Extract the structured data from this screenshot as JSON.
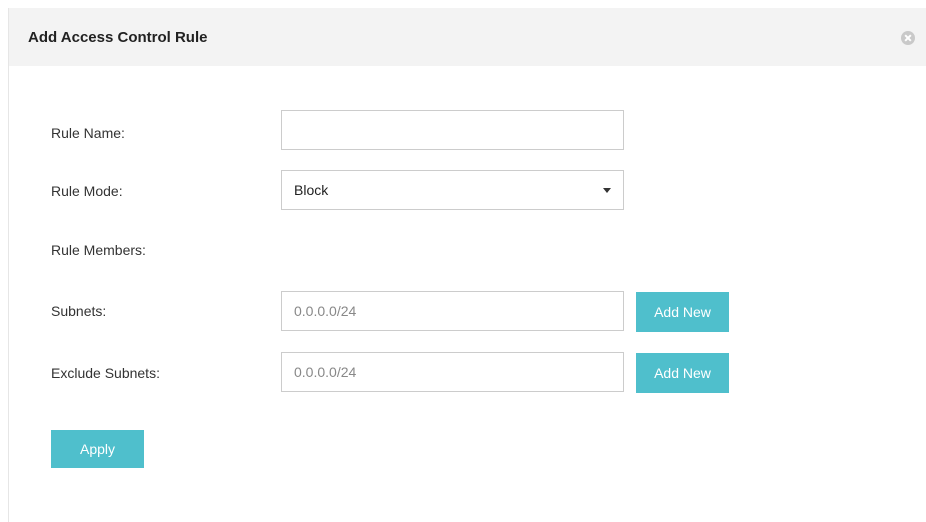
{
  "dialog": {
    "title": "Add Access Control Rule",
    "close_icon": "close-circle-icon"
  },
  "form": {
    "rule_name": {
      "label": "Rule Name:",
      "value": "",
      "placeholder": ""
    },
    "rule_mode": {
      "label": "Rule Mode:",
      "value": "Block",
      "icon": "caret-down-icon"
    },
    "rule_members": {
      "label": "Rule Members:"
    },
    "subnets": {
      "label": "Subnets:",
      "placeholder": "0.0.0.0/24",
      "add_label": "Add New"
    },
    "exclude_subnets": {
      "label": "Exclude Subnets:",
      "placeholder": "0.0.0.0/24",
      "add_label": "Add New"
    },
    "apply_label": "Apply"
  },
  "colors": {
    "accent": "#4fbfcc",
    "header_bg": "#f3f3f3",
    "border": "#cccccc"
  }
}
